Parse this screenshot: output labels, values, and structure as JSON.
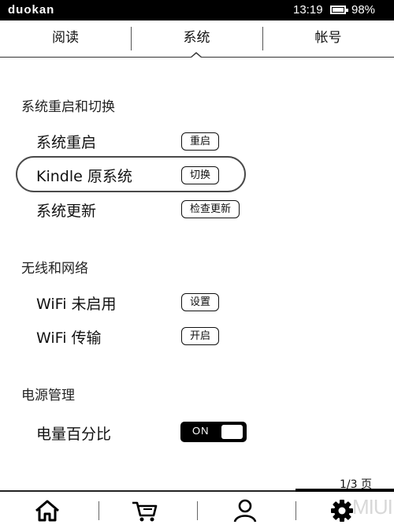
{
  "status_bar": {
    "brand": "duokan",
    "time": "13:19",
    "battery": "98%",
    "battery_level": 0.98
  },
  "tabs": [
    {
      "label": "阅读"
    },
    {
      "label": "系统"
    },
    {
      "label": "帐号"
    }
  ],
  "sections": [
    {
      "title": "系统重启和切换",
      "rows": [
        {
          "label": "系统重启",
          "button": "重启"
        },
        {
          "label": "Kindle 原系统",
          "button": "切换"
        },
        {
          "label": "系统更新",
          "button": "检查更新"
        }
      ]
    },
    {
      "title": "无线和网络",
      "rows": [
        {
          "label": "WiFi 未启用",
          "button": "设置"
        },
        {
          "label": "WiFi 传输",
          "button": "开启"
        }
      ]
    },
    {
      "title": "电源管理",
      "rows": [
        {
          "label": "电量百分比",
          "toggle": "ON"
        }
      ]
    }
  ],
  "pager": "1/3 页",
  "bottom_nav": {
    "items": [
      "home-icon",
      "cart-icon",
      "user-icon",
      "gear-icon"
    ]
  },
  "watermark": "MIUI"
}
